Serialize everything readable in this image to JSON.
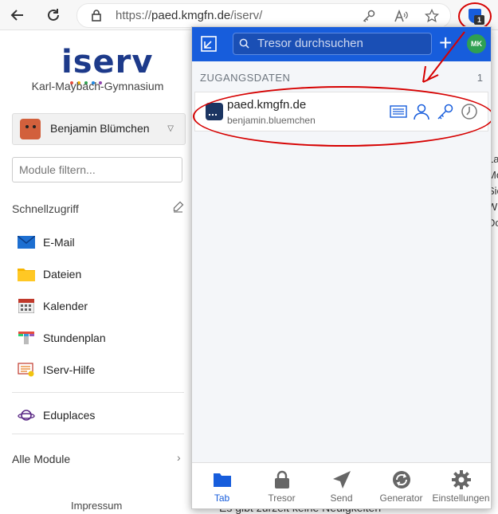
{
  "browser": {
    "url_prefix": "https://",
    "url_host": "paed.kmgfn.de",
    "url_path": "/iserv/",
    "extension_badge": "1"
  },
  "iserv": {
    "logo": "iserv",
    "school": "Karl-Maybach-Gymnasium",
    "user": "Benjamin Blümchen",
    "filter_placeholder": "Module filtern...",
    "quick_access": "Schnellzugriff",
    "nav": [
      {
        "label": "E-Mail",
        "icon": "mail-icon"
      },
      {
        "label": "Dateien",
        "icon": "folder-icon"
      },
      {
        "label": "Kalender",
        "icon": "calendar-icon"
      },
      {
        "label": "Stundenplan",
        "icon": "timetable-icon"
      },
      {
        "label": "IServ-Hilfe",
        "icon": "help-icon"
      },
      {
        "label": "Eduplaces",
        "icon": "planet-icon"
      }
    ],
    "all_modules": "Alle Module",
    "impressum": "Impressum",
    "news": "Es gibt zurzeit keine Neuigkeiten",
    "right_snippet": "La Mo Sie W Do"
  },
  "bitwarden": {
    "search_placeholder": "Tresor durchsuchen",
    "account_initials": "MK",
    "section_title": "ZUGANGSDATEN",
    "section_count": "1",
    "login": {
      "name": "paed.kmgfn.de",
      "username": "benjamin.bluemchen"
    },
    "tabs": [
      {
        "label": "Tab",
        "icon": "folder-icon",
        "active": true
      },
      {
        "label": "Tresor",
        "icon": "lock-icon",
        "active": false
      },
      {
        "label": "Send",
        "icon": "send-icon",
        "active": false
      },
      {
        "label": "Generator",
        "icon": "generator-icon",
        "active": false
      },
      {
        "label": "Einstellungen",
        "icon": "settings-icon",
        "active": false
      }
    ],
    "colors": {
      "brand": "#175ddc",
      "annotation": "#d60000"
    }
  }
}
